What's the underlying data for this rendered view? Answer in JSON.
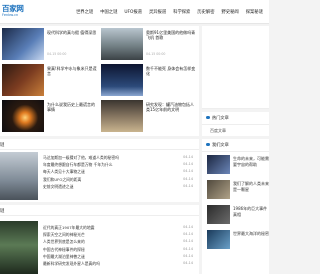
{
  "header": {
    "logo_main": "百家网",
    "logo_sub": "Fenbw.cn",
    "nav": [
      "世界之谜",
      "中国之谜",
      "UFO报道",
      "灵异报道",
      "科学探索",
      "历史解密",
      "野史秘闻",
      "探案秘谜"
    ]
  },
  "cards": [
    {
      "title": "现代科学的真与假 值得深思",
      "meta": "04-15 00:00"
    },
    {
      "title": "奥斯91亿里美国的他做吗青飞机 首歌",
      "meta": "04-15 00:00"
    },
    {
      "title": "果真!科学中水与象米只是谎言",
      "meta": ""
    },
    {
      "title": "数千不能死 身体会有怎样变化",
      "meta": ""
    },
    {
      "title": "为什么说我历史上最谎言的事情",
      "meta": ""
    },
    {
      "title": "研究发现：罐汽油物包括人类15亿年前的文明",
      "meta": ""
    }
  ],
  "section1": {
    "head": "谜",
    "rows": [
      {
        "text": "马达加斯加一级猜对了他，难道人类的秘密吗",
        "date": "04-14"
      },
      {
        "text": "年度最终想跟自行车都是万物 千年为什么",
        "date": "04-14"
      },
      {
        "text": "每天人类见十大事物之谜",
        "date": "04-14"
      },
      {
        "text": "我们和UFO之间的距离",
        "date": "04-14"
      },
      {
        "text": "史前文明遗迹之谜",
        "date": "04-14"
      }
    ]
  },
  "section2": {
    "head": "谜",
    "rows": [
      {
        "text": "近代的真正1907年最大的地震",
        "date": "04-14"
      },
      {
        "text": "探索天空之间的神秘光芒",
        "date": "04-14"
      },
      {
        "text": "人类世界到底是怎么来的",
        "date": "04-14"
      },
      {
        "text": "中国古代神秘事件的探秘",
        "date": "04-14"
      },
      {
        "text": "中国最大湖泊里神兽之谜",
        "date": "04-14"
      },
      {
        "text": "最新科学研究发现外星人是真的吗",
        "date": "04-14"
      }
    ]
  },
  "sidebar": {
    "top_tabs": [
      "热门文章"
    ],
    "ad_text": "百度文章",
    "rec_head": "我们文章",
    "recs": [
      {
        "title": "生命的未来，可能需要宇宙的帮助"
      },
      {
        "title": "我们了解的人类未来是一颗星"
      },
      {
        "title": "1986年的巨大事件真相"
      },
      {
        "title": "世界最大海洋的秘密"
      }
    ]
  },
  "colors": {
    "accent": "#1e73be"
  }
}
